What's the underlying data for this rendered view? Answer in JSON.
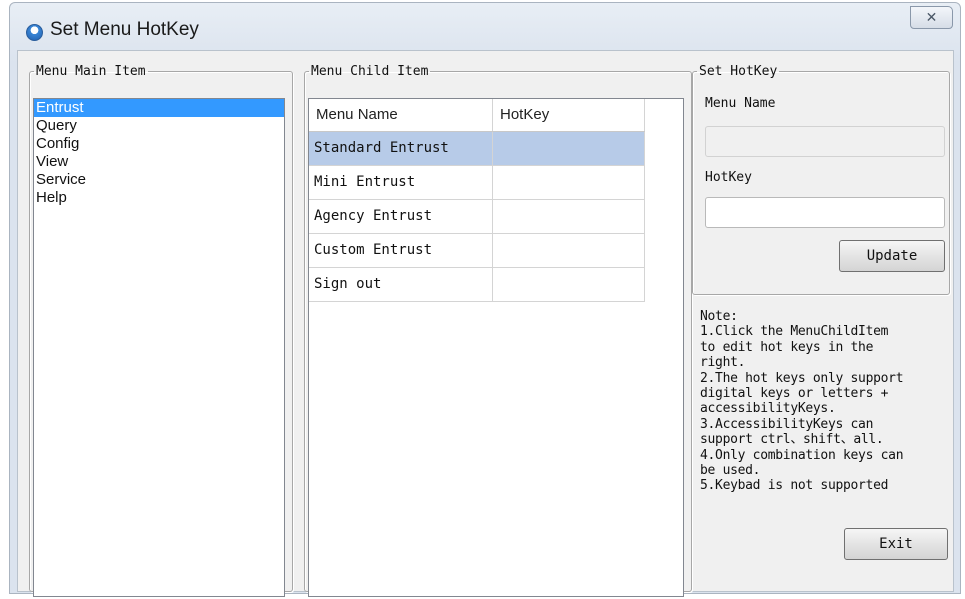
{
  "window": {
    "title": "Set Menu HotKey",
    "close_glyph": "✕",
    "icon": "app-globe-icon"
  },
  "main_item": {
    "legend": "Menu Main Item",
    "items": [
      "Entrust",
      "Query",
      "Config",
      "View",
      "Service",
      "Help"
    ],
    "selected_index": 0
  },
  "child_item": {
    "legend": "Menu Child Item",
    "columns": [
      "Menu Name",
      "HotKey"
    ],
    "rows": [
      {
        "name": "Standard Entrust",
        "hotkey": ""
      },
      {
        "name": "Mini Entrust",
        "hotkey": ""
      },
      {
        "name": "Agency Entrust",
        "hotkey": ""
      },
      {
        "name": "Custom Entrust",
        "hotkey": ""
      },
      {
        "name": "Sign out",
        "hotkey": ""
      }
    ],
    "selected_index": 0
  },
  "set_hotkey": {
    "legend": "Set HotKey",
    "menu_name_label": "Menu Name",
    "menu_name_value": "",
    "hotkey_label": "HotKey",
    "hotkey_value": "",
    "update_label": "Update"
  },
  "note": {
    "text": "Note:\n1.Click the MenuChildItem\nto edit hot keys in the\nright.\n2.The hot keys only support\ndigital keys or letters +\naccessibilityKeys.\n3.AccessibilityKeys can\nsupport ctrl、shift、all.\n4.Only combination keys can\nbe used.\n5.Keybad is not supported"
  },
  "exit_label": "Exit",
  "colors": {
    "selection_list": "#3399ff",
    "selection_grid": "#b7cbe8",
    "dialog_bg": "#f0f0f0"
  }
}
